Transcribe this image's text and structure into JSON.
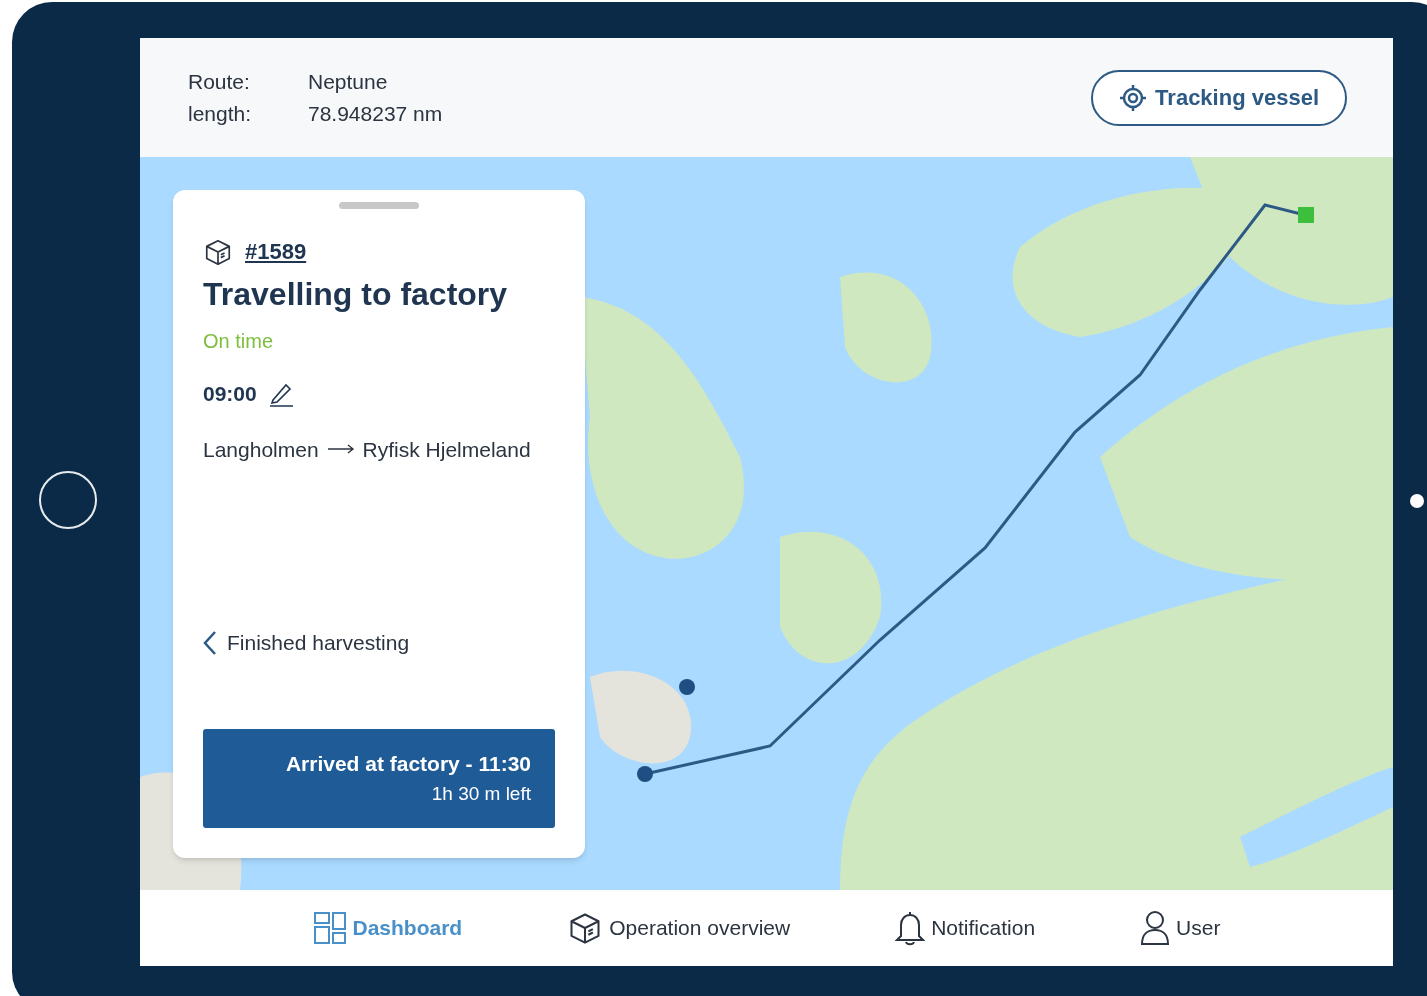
{
  "header": {
    "fields": [
      {
        "label": "Route:",
        "value": "Neptune"
      },
      {
        "label": "length:",
        "value": "78.948237 nm"
      }
    ],
    "tracking_button": "Tracking vessel"
  },
  "card": {
    "order": "#1589",
    "title": "Travelling to factory",
    "status": "On time",
    "time": "09:00",
    "from": "Langholmen",
    "to": "Ryfisk Hjelmeland",
    "back_link": "Finished harvesting",
    "action": {
      "label": "Arrived at factory - 11:30",
      "sublabel": "1h 30 m left"
    }
  },
  "nav": [
    {
      "label": "Dashboard",
      "selected": true
    },
    {
      "label": "Operation overview",
      "selected": false
    },
    {
      "label": "Notification",
      "selected": false
    },
    {
      "label": "User",
      "selected": false
    }
  ]
}
